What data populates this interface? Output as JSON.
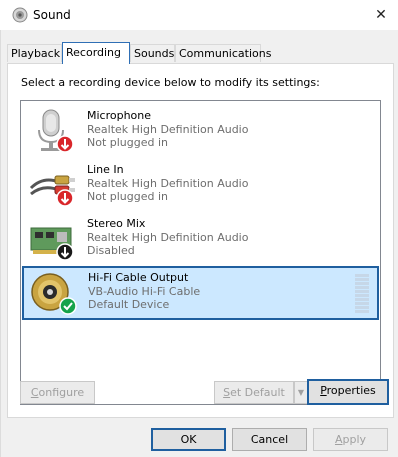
{
  "window": {
    "title": "Sound",
    "close_glyph": "✕"
  },
  "tabs": [
    {
      "label": "Playback",
      "active": false
    },
    {
      "label": "Recording",
      "active": true
    },
    {
      "label": "Sounds",
      "active": false
    },
    {
      "label": "Communications",
      "active": false
    }
  ],
  "instruction": "Select a recording device below to modify its settings:",
  "devices": [
    {
      "name": "Microphone",
      "driver": "Realtek High Definition Audio",
      "status": "Not plugged in",
      "icon": "microphone-icon",
      "badge": "red-down-arrow",
      "selected": false
    },
    {
      "name": "Line In",
      "driver": "Realtek High Definition Audio",
      "status": "Not plugged in",
      "icon": "rca-cable-icon",
      "badge": "red-down-arrow",
      "selected": false
    },
    {
      "name": "Stereo Mix",
      "driver": "Realtek High Definition Audio",
      "status": "Disabled",
      "icon": "sound-card-icon",
      "badge": "black-down-arrow",
      "selected": false
    },
    {
      "name": "Hi-Fi Cable Output",
      "driver": "VB-Audio Hi-Fi Cable",
      "status": "Default Device",
      "icon": "rca-jack-icon",
      "badge": "green-check",
      "selected": true
    }
  ],
  "buttons": {
    "configure": {
      "prefix": "",
      "mnemonic": "C",
      "rest": "onfigure"
    },
    "set_default": {
      "prefix": "",
      "mnemonic": "S",
      "rest": "et Default"
    },
    "properties": {
      "prefix": "",
      "mnemonic": "P",
      "rest": "roperties"
    },
    "ok": "OK",
    "cancel": "Cancel",
    "apply": {
      "prefix": "",
      "mnemonic": "A",
      "rest": "pply"
    }
  },
  "colors": {
    "selection_bg": "#cce8ff",
    "selection_border": "#1f5f9f",
    "red_badge": "#d9262a",
    "green_badge": "#16a34a"
  }
}
